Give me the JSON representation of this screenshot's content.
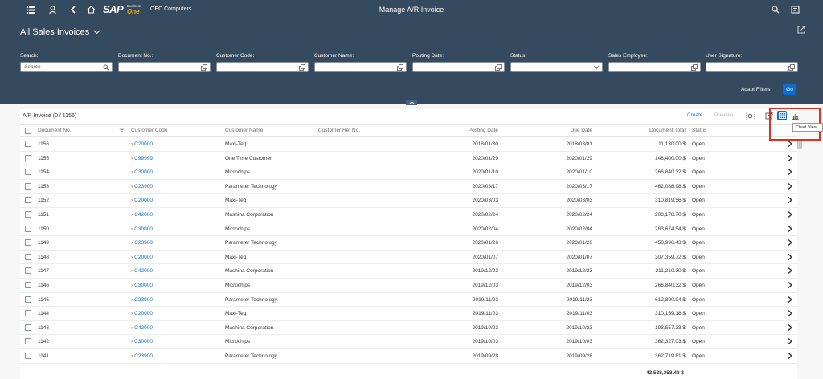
{
  "shell": {
    "brand_sap": "SAP",
    "brand_business": "Business",
    "brand_one": "One",
    "company": "OEC Computers",
    "title": "Manage A/R Invoice",
    "icons": [
      "menu-icon",
      "user-icon",
      "back-icon",
      "home-icon",
      "search-icon",
      "notifications-icon"
    ]
  },
  "header": {
    "variant": "All Sales Invoices",
    "filters": [
      {
        "label": "Search:",
        "value": "Search",
        "icon": "search-icon"
      },
      {
        "label": "Document No.:",
        "value": "",
        "icon": "value-help-icon"
      },
      {
        "label": "Customer Code:",
        "value": "",
        "icon": "value-help-icon"
      },
      {
        "label": "Customer Name:",
        "value": "",
        "icon": "value-help-icon"
      },
      {
        "label": "Posting Date:",
        "value": "",
        "icon": "value-help-icon"
      },
      {
        "label": "Status:",
        "value": "",
        "icon": "chevron-down-icon"
      },
      {
        "label": "Sales Employee:",
        "value": "",
        "icon": "value-help-icon"
      },
      {
        "label": "User Signature:",
        "value": "",
        "icon": "value-help-icon"
      }
    ],
    "adapt_filters": "Adapt Filters",
    "go": "Go"
  },
  "table": {
    "title": "A/R Invoice (0 / 1156)",
    "create": "Create",
    "preview": "Preview",
    "tooltip": "Chart View",
    "columns": [
      "Document No.",
      "Customer Code",
      "Customer Name",
      "Customer Ref No.",
      "Posting Date",
      "Due Date",
      "Document Total",
      "Status"
    ],
    "rows": [
      {
        "doc": "1156",
        "code": "C20000",
        "name": "Maxi-Teq",
        "ref": "",
        "posting": "2018/01/30",
        "due": "2018/03/01",
        "total": "11,130.00 $",
        "status": "Open"
      },
      {
        "doc": "1155",
        "code": "C99999",
        "name": "One Time Customer",
        "ref": "",
        "posting": "2020/01/29",
        "due": "2020/01/29",
        "total": "148,400.00 $",
        "status": "Open"
      },
      {
        "doc": "1154",
        "code": "C30000",
        "name": "Microchips",
        "ref": "",
        "posting": "2020/01/10",
        "due": "2020/01/10",
        "total": "266,840.32 $",
        "status": "Open"
      },
      {
        "doc": "1153",
        "code": "C23900",
        "name": "Parameter Technology",
        "ref": "",
        "posting": "2020/03/17",
        "due": "2020/03/17",
        "total": "462,088.98 $",
        "status": "Open"
      },
      {
        "doc": "1152",
        "code": "C20000",
        "name": "Maxi-Teq",
        "ref": "",
        "posting": "2020/03/03",
        "due": "2020/03/03",
        "total": "310,819.56 $",
        "status": "Open"
      },
      {
        "doc": "1151",
        "code": "C42000",
        "name": "Mashina Corporation",
        "ref": "",
        "posting": "2020/02/24",
        "due": "2020/02/24",
        "total": "208,178.70 $",
        "status": "Open"
      },
      {
        "doc": "1150",
        "code": "C30000",
        "name": "Microchips",
        "ref": "",
        "posting": "2020/02/04",
        "due": "2020/02/04",
        "total": "283,674.54 $",
        "status": "Open"
      },
      {
        "doc": "1149",
        "code": "C23900",
        "name": "Parameter Technology",
        "ref": "",
        "posting": "2020/01/26",
        "due": "2020/01/26",
        "total": "458,996.43 $",
        "status": "Open"
      },
      {
        "doc": "1148",
        "code": "C20000",
        "name": "Maxi-Teq",
        "ref": "",
        "posting": "2020/01/07",
        "due": "2020/01/07",
        "total": "307,359.72 $",
        "status": "Open"
      },
      {
        "doc": "1147",
        "code": "C42000",
        "name": "Mashina Corporation",
        "ref": "",
        "posting": "2019/12/23",
        "due": "2019/12/23",
        "total": "211,210.30 $",
        "status": "Open"
      },
      {
        "doc": "1146",
        "code": "C30000",
        "name": "Microchips",
        "ref": "",
        "posting": "2019/12/03",
        "due": "2019/12/03",
        "total": "266,840.32 $",
        "status": "Open"
      },
      {
        "doc": "1145",
        "code": "C23900",
        "name": "Parameter Technology",
        "ref": "",
        "posting": "2019/11/23",
        "due": "2019/11/23",
        "total": "612,890.94 $",
        "status": "Open"
      },
      {
        "doc": "1144",
        "code": "C20000",
        "name": "Maxi-Teq",
        "ref": "",
        "posting": "2019/11/03",
        "due": "2019/11/03",
        "total": "310,159.18 $",
        "status": "Open"
      },
      {
        "doc": "1143",
        "code": "C42000",
        "name": "Mashina Corporation",
        "ref": "",
        "posting": "2019/10/23",
        "due": "2019/10/23",
        "total": "193,557.33 $",
        "status": "Open"
      },
      {
        "doc": "1142",
        "code": "C30000",
        "name": "Microchips",
        "ref": "",
        "posting": "2019/10/03",
        "due": "2019/10/03",
        "total": "362,327.03 $",
        "status": "Open"
      },
      {
        "doc": "1141",
        "code": "C23900",
        "name": "Parameter Technology",
        "ref": "",
        "posting": "2019/09/28",
        "due": "2019/09/28",
        "total": "362,719.81 $",
        "status": "Open"
      }
    ],
    "grand_total": "43,528,358.48 $"
  },
  "colors": {
    "shell": "#354a5f",
    "accent": "#0a6ed1",
    "link_arrow": "#e9730c",
    "highlight": "#e0301e"
  }
}
